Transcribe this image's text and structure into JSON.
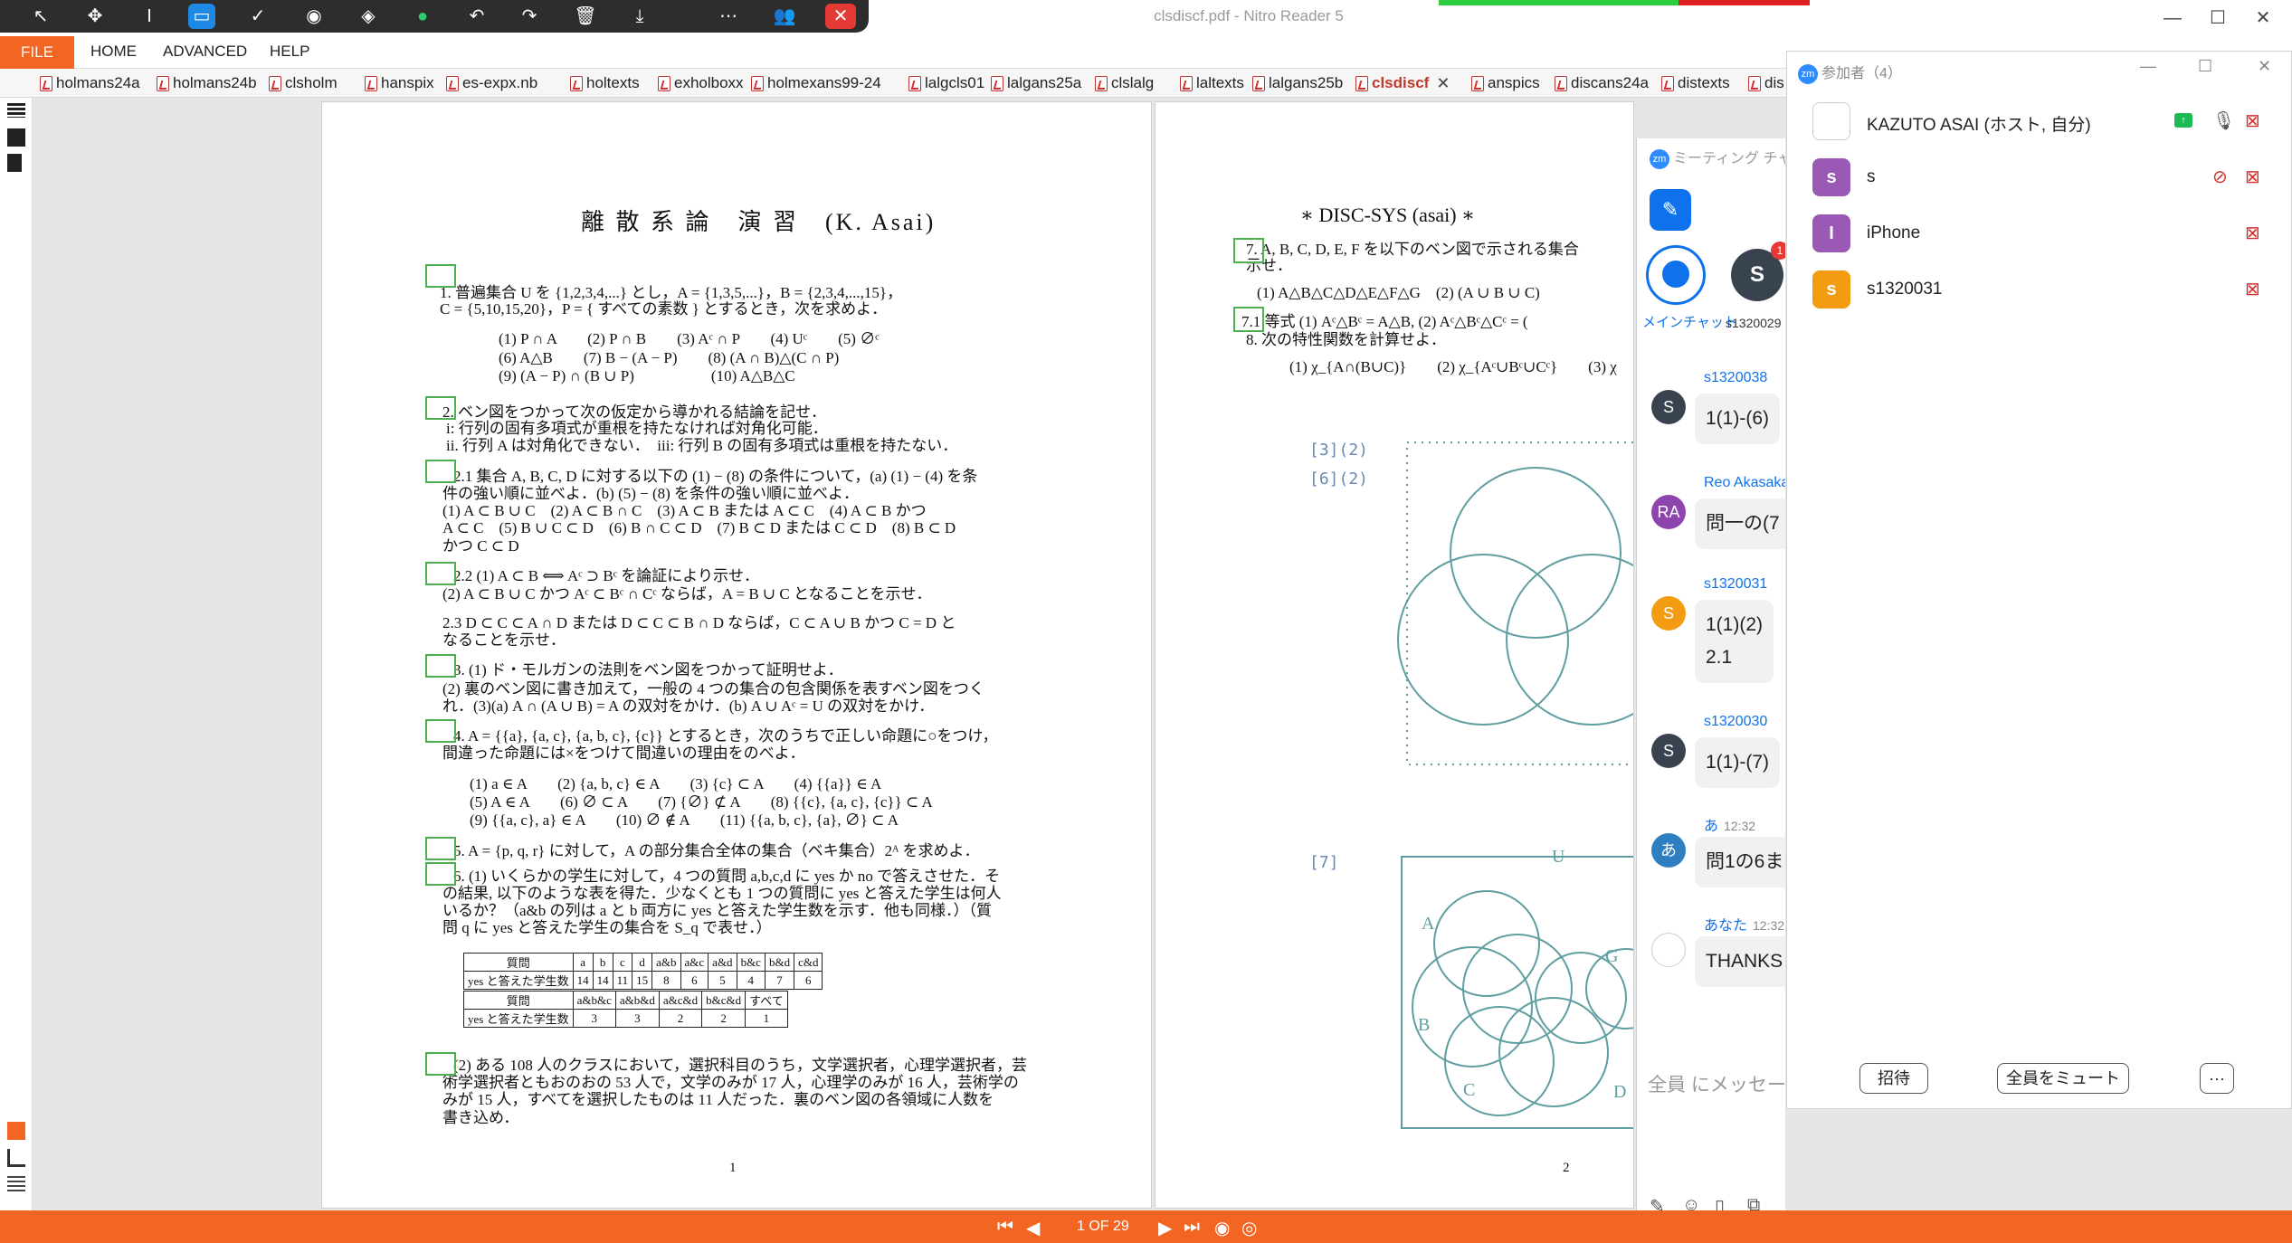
{
  "window": {
    "title": "clsdiscf.pdf - Nitro Reader 5",
    "min": "—",
    "max": "☐",
    "close": "✕"
  },
  "menu": [
    "FILE",
    "HOME",
    "ADVANCED",
    "HELP"
  ],
  "tabs": [
    "holmans24a",
    "holmans24b",
    "clsholm",
    "hanspix",
    "es-expx.nb",
    "holtexts",
    "exholboxx",
    "holmexans99-24",
    "lalgcls01",
    "lalgans25a",
    "clslalg",
    "laltexts",
    "lalgans25b",
    "clsdiscf",
    "anspics",
    "discans24a",
    "distexts",
    "dis"
  ],
  "active_tab": "clsdiscf",
  "floatbar": {
    "icons": [
      "cursor-icon",
      "pan-icon",
      "text-cursor-icon",
      "rectangle-icon",
      "check-icon",
      "stamp-icon",
      "eraser-icon",
      "color-dot-icon",
      "undo-icon",
      "redo-icon",
      "trash-icon",
      "download-icon",
      "more-icon",
      "people-icon",
      "close-icon"
    ]
  },
  "page1": {
    "title": "離 散 系 論　演 習　(K. Asai)",
    "lines": [
      "1. 普遍集合 U を {1,2,3,4,...} とし，A = {1,3,5,...}，B = {2,3,4,...,15}，",
      "C = {5,10,15,20}，P = { すべての素数 } とするとき，次を求めよ．",
      "(1) P ∩ A　　(2) P ∩ B　　(3) Aᶜ ∩ P　　(4) Uᶜ　　(5) ∅ᶜ",
      "(6) A△B　　(7) B − (A − P)　　(8) (A ∩ B)△(C ∩ P)",
      "(9) (A − P) ∩ (B ∪ P)　　　　　(10) A△B△C",
      "2. ベン図をつかって次の仮定から導かれる結論を記せ．",
      "i: 行列の固有多項式が重根を持たなければ対角化可能．",
      "ii. 行列 A は対角化できない．　iii: 行列 B の固有多項式は重根を持たない．",
      "2.1 集合 A, B, C, D に対する以下の (1) − (8) の条件について，(a) (1) − (4) を条",
      "件の強い順に並べよ．(b) (5) − (8) を条件の強い順に並べよ．",
      "(1) A ⊂ B ∪ C　(2) A ⊂ B ∩ C　(3) A ⊂ B または A ⊂ C　(4) A ⊂ B かつ",
      "A ⊂ C　(5) B ∪ C ⊂ D　(6) B ∩ C ⊂ D　(7) B ⊂ D または C ⊂ D　(8) B ⊂ D",
      "かつ C ⊂ D",
      "2.2 (1) A ⊂ B ⟺ Aᶜ ⊃ Bᶜ を論証により示せ．",
      "(2) A ⊂ B ∪ C かつ Aᶜ ⊂ Bᶜ ∩ Cᶜ ならば，A = B ∪ C となることを示せ．",
      "2.3 D ⊂ C ⊂ A ∩ D または D ⊂ C ⊂ B ∩ D ならば，C ⊂ A ∪ B かつ C = D と",
      "なることを示せ．",
      "3. (1) ド・モルガンの法則をベン図をつかって証明せよ．",
      "(2) 裏のベン図に書き加えて，一般の 4 つの集合の包含関係を表すベン図をつく",
      "れ．(3)(a) A ∩ (A ∪ B) = A の双対をかけ．(b) A ∪ Aᶜ = U の双対をかけ．",
      "4. A = {{a}, {a, c}, {a, b, c}, {c}} とするとき，次のうちで正しい命題に○をつけ，",
      "間違った命題には×をつけて間違いの理由をのべよ．",
      "(1) a ∈ A　　(2) {a, b, c} ∈ A　　(3) {c} ⊂ A　　(4) {{a}} ∈ A",
      "(5) A ∈ A　　(6) ∅ ⊂ A　　(7) {∅} ⊄ A　　(8) {{c}, {a, c}, {c}} ⊂ A",
      "(9) {{a, c}, a} ∈ A　　(10) ∅ ∉ A　　(11) {{a, b, c}, {a}, ∅} ⊂ A",
      "5. A = {p, q, r} に対して，A の部分集合全体の集合（ベキ集合）2ᴬ を求めよ．",
      "6. (1) いくらかの学生に対して，4 つの質問 a,b,c,d に yes か no で答えさせた．そ",
      "の結果, 以下のような表を得た．少なくとも 1 つの質問に yes と答えた学生は何人",
      "いるか？（a&b の列は a と b 両方に yes と答えた学生数を示す．他も同様．）（質",
      "問 q に yes と答えた学生の集合を S_q で表せ．）",
      "(2) ある 108 人のクラスにおいて，選択科目のうち，文学選択者，心理学選択者，芸",
      "術学選択者ともおのおの 53 人で，文学のみが 17 人，心理学のみが 16 人，芸術学の",
      "みが 15 人，すべてを選択したものは 11 人だった．裏のベン図の各領域に人数を",
      "書き込め．"
    ],
    "table1_head": [
      "質問",
      "a",
      "b",
      "c",
      "d",
      "a&b",
      "a&c",
      "a&d",
      "b&c",
      "b&d",
      "c&d"
    ],
    "table1_row": [
      "yes と答えた学生数",
      "14",
      "14",
      "11",
      "15",
      "8",
      "6",
      "5",
      "4",
      "7",
      "6"
    ],
    "table2_head": [
      "質問",
      "a&b&c",
      "a&b&d",
      "a&c&d",
      "b&c&d",
      "すべて"
    ],
    "table2_row": [
      "yes と答えた学生数",
      "3",
      "3",
      "2",
      "2",
      "1"
    ],
    "page_number": "1"
  },
  "page2": {
    "title": "∗ DISC-SYS (asai) ∗",
    "lines": [
      "7. A, B, C, D, E, F を以下のベン図で示される集合",
      "示せ．",
      "(1) A△B△C△D△E△F△G　(2) (A ∪ B ∪ C)",
      "7.1 等式 (1) Aᶜ△Bᶜ = A△B, (2) Aᶜ△Bᶜ△Cᶜ = (",
      "8. 次の特性関数を計算せよ．",
      "(1) χ_{A∩(B∪C)}　　(2) χ_{Aᶜ∪Bᶜ∪Cᶜ}　　(3) χ"
    ],
    "marks": [
      "[3](2)",
      "[6](2)",
      "[7]"
    ],
    "venn_labels": [
      "U",
      "A",
      "B",
      "C",
      "D",
      "G"
    ],
    "page_number": "2"
  },
  "status": {
    "page_indicator": "1 OF 29"
  },
  "chat": {
    "title": "ミーティング チャット",
    "main_label": "メインチャット",
    "dm_label": "s1320029",
    "dm_initial": "S",
    "dm_badge": "1",
    "messages": [
      {
        "name": "s1320038",
        "time": "",
        "initial": "S",
        "color": "#39434f",
        "text": [
          "1(1)-(6)"
        ]
      },
      {
        "name": "Reo Akasaka",
        "time": "",
        "initial": "RA",
        "color": "#8e44ad",
        "text": [
          "問一の(7"
        ]
      },
      {
        "name": "s1320031",
        "time": "",
        "initial": "S",
        "color": "#f39c12",
        "text": [
          "1(1)(2)",
          "2.1"
        ]
      },
      {
        "name": "s1320030",
        "time": "",
        "initial": "S",
        "color": "#39434f",
        "text": [
          "1(1)-(7)"
        ]
      },
      {
        "name": "あ",
        "time": "12:32",
        "initial": "あ",
        "color": "#2d7fc1",
        "text": [
          "問1の6ま"
        ]
      },
      {
        "name": "あなた",
        "time": "12:32",
        "initial": "",
        "color": "#ffffff",
        "text": [
          "THANKS"
        ]
      }
    ],
    "input_placeholder": "全員 にメッセージ"
  },
  "participants": {
    "title": "参加者（4）",
    "list": [
      {
        "name": "KAZUTO ASAI (ホスト, 自分)",
        "initial": "",
        "color": "#ffffff"
      },
      {
        "name": "s",
        "initial": "s",
        "color": "#9b59b6"
      },
      {
        "name": "iPhone",
        "initial": "I",
        "color": "#9b59b6"
      },
      {
        "name": "s1320031",
        "initial": "s",
        "color": "#f39c12"
      }
    ],
    "buttons": {
      "invite": "招待",
      "mute_all": "全員をミュート",
      "more": "···"
    }
  },
  "colors": {
    "nitro_orange": "#f26522",
    "zoom_blue": "#0e72ed",
    "venn_teal": "#5f9ea0",
    "annot_green": "#4caf50"
  }
}
